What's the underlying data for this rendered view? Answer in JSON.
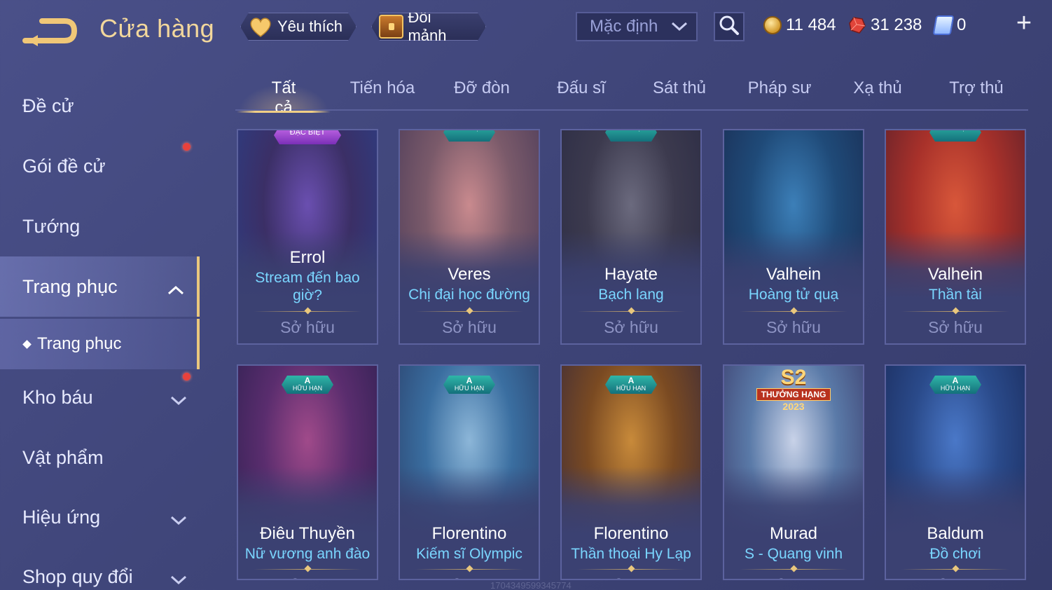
{
  "header": {
    "title": "Cửa hàng",
    "favorites_label": "Yêu thích",
    "exchange_label": "Đổi mảnh",
    "sort_value": "Mặc định",
    "currencies": {
      "gold": "11 484",
      "ruby": "31 238",
      "voucher": "0"
    },
    "add_label": "+"
  },
  "sidebar": {
    "items": [
      {
        "label": "Đề cử"
      },
      {
        "label": "Gói đề cử"
      },
      {
        "label": "Tướng"
      },
      {
        "label": "Trang phục"
      },
      {
        "label": "Kho báu"
      },
      {
        "label": "Vật phẩm"
      },
      {
        "label": "Hiệu ứng"
      },
      {
        "label": "Shop quy đổi"
      }
    ],
    "sub_item": "Trang phục"
  },
  "tabs": [
    {
      "label": "Tất cả"
    },
    {
      "label": "Tiến hóa"
    },
    {
      "label": "Đỡ đòn"
    },
    {
      "label": "Đấu sĩ"
    },
    {
      "label": "Sát thủ"
    },
    {
      "label": "Pháp sư"
    },
    {
      "label": "Xạ thủ"
    },
    {
      "label": "Trợ thủ"
    }
  ],
  "cards": [
    {
      "hero": "Errol",
      "skin": "Stream đến bao giờ?",
      "status": "Sở hữu",
      "badge": "ĐẶC BIỆT",
      "art": [
        "#3b2f66",
        "#6a4fb0",
        "#2b3f86"
      ]
    },
    {
      "hero": "Veres",
      "skin": "Chị đại học đường",
      "status": "Sở hữu",
      "badge": "HỮU HẠN",
      "art": [
        "#7a5a6a",
        "#c98a8e",
        "#4a3a58"
      ]
    },
    {
      "hero": "Hayate",
      "skin": "Bạch lang",
      "status": "Sở hữu",
      "badge": "HỮU HẠN",
      "art": [
        "#3c3a4e",
        "#6b6a7e",
        "#2a2b44"
      ]
    },
    {
      "hero": "Valhein",
      "skin": "Hoàng tử quạ",
      "status": "Sở hữu",
      "badge": "",
      "art": [
        "#1f4a78",
        "#3c7fb8",
        "#1a2c52"
      ]
    },
    {
      "hero": "Valhein",
      "skin": "Thần tài",
      "status": "Sở hữu",
      "badge": "HỮU HẠN",
      "art": [
        "#a8312a",
        "#d8573a",
        "#5a1f2a"
      ]
    },
    {
      "hero": "Điêu Thuyền",
      "skin": "Nữ vương anh đào",
      "status": "Sở hữu",
      "badge_rank": "A",
      "badge": "HỮU HẠN",
      "art": [
        "#5a2d6e",
        "#a04a8a",
        "#2d2050"
      ]
    },
    {
      "hero": "Florentino",
      "skin": "Kiếm sĩ Olympic",
      "status": "Sở hữu",
      "badge_rank": "A",
      "badge": "HỮU HẠN",
      "art": [
        "#3a6ea0",
        "#8cb6d8",
        "#2a3f6a"
      ]
    },
    {
      "hero": "Florentino",
      "skin": "Thần thoại Hy Lạp",
      "status": "Sở hữu",
      "badge_rank": "A",
      "badge": "HỮU HẠN",
      "art": [
        "#7a4a22",
        "#c88a3a",
        "#3a2a3a"
      ]
    },
    {
      "hero": "Murad",
      "skin": "S - Quang vinh",
      "status": "Sở hữu",
      "event": {
        "big": "S2",
        "mid": "THƯỞNG HẠNG",
        "yr": "2023"
      },
      "art": [
        "#5a7aa8",
        "#c8d2e8",
        "#3a3a6a"
      ]
    },
    {
      "hero": "Baldum",
      "skin": "Đồ chơi",
      "status": "Sở hữu",
      "badge_rank": "A",
      "badge": "HỮU HẠN",
      "art": [
        "#2a4a8a",
        "#4a78c8",
        "#1a2a5a"
      ]
    }
  ],
  "watermark": "1704349599345774",
  "colors": {
    "accent_gold": "#e9c77d",
    "skin_name": "#7ad6ff",
    "badge_teal": "#2fb6a8",
    "notification_red": "#e8413c"
  }
}
